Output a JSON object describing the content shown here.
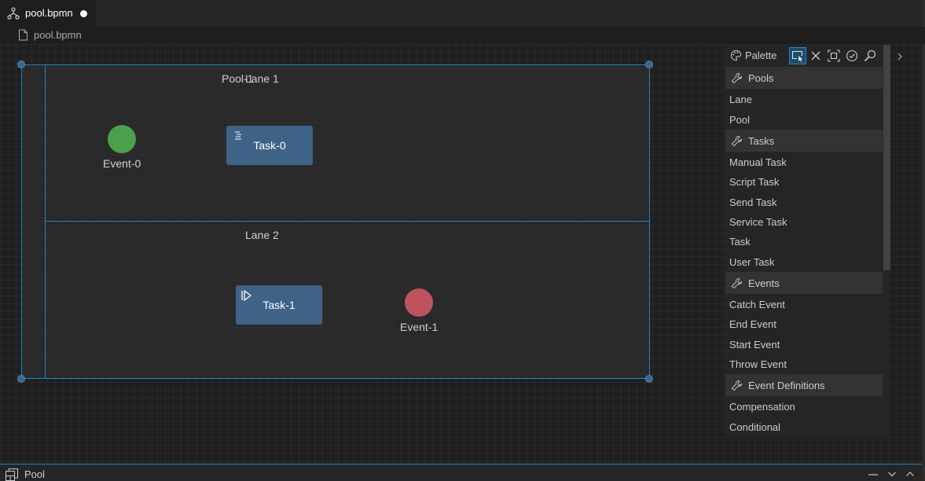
{
  "tab": {
    "title": "pool.bpmn",
    "icon": "bpmn-diagram-icon",
    "dirty": true
  },
  "breadcrumb": {
    "file": "pool.bpmn",
    "icon": "file-icon"
  },
  "diagram": {
    "pool": {
      "label": "Pool-1"
    },
    "lanes": [
      {
        "label": "Lane 1"
      },
      {
        "label": "Lane 2"
      }
    ],
    "events": [
      {
        "label": "Event-0",
        "color": "#4c9f4c"
      },
      {
        "label": "Event-1",
        "color": "#c0525e"
      }
    ],
    "tasks": [
      {
        "label": "Task-0",
        "marker": "script-task-icon"
      },
      {
        "label": "Task-1",
        "marker": "manual-task-icon"
      }
    ],
    "colors": {
      "selection": "#1f86c8",
      "task_fill": "#3f6287"
    }
  },
  "palette": {
    "title": "Palette",
    "tools": [
      "select-tool",
      "delete-tool",
      "fit-to-screen-tool",
      "validate-tool",
      "search-tool"
    ],
    "groups": [
      {
        "label": "Pools",
        "items": [
          "Lane",
          "Pool"
        ]
      },
      {
        "label": "Tasks",
        "items": [
          "Manual Task",
          "Script Task",
          "Send Task",
          "Service Task",
          "Task",
          "User Task"
        ]
      },
      {
        "label": "Events",
        "items": [
          "Catch Event",
          "End Event",
          "Start Event",
          "Throw Event"
        ]
      },
      {
        "label": "Event Definitions",
        "items": [
          "Compensation",
          "Conditional"
        ]
      }
    ]
  },
  "bottom_panel": {
    "title": "Pool",
    "icon": "properties-panel-icon"
  }
}
